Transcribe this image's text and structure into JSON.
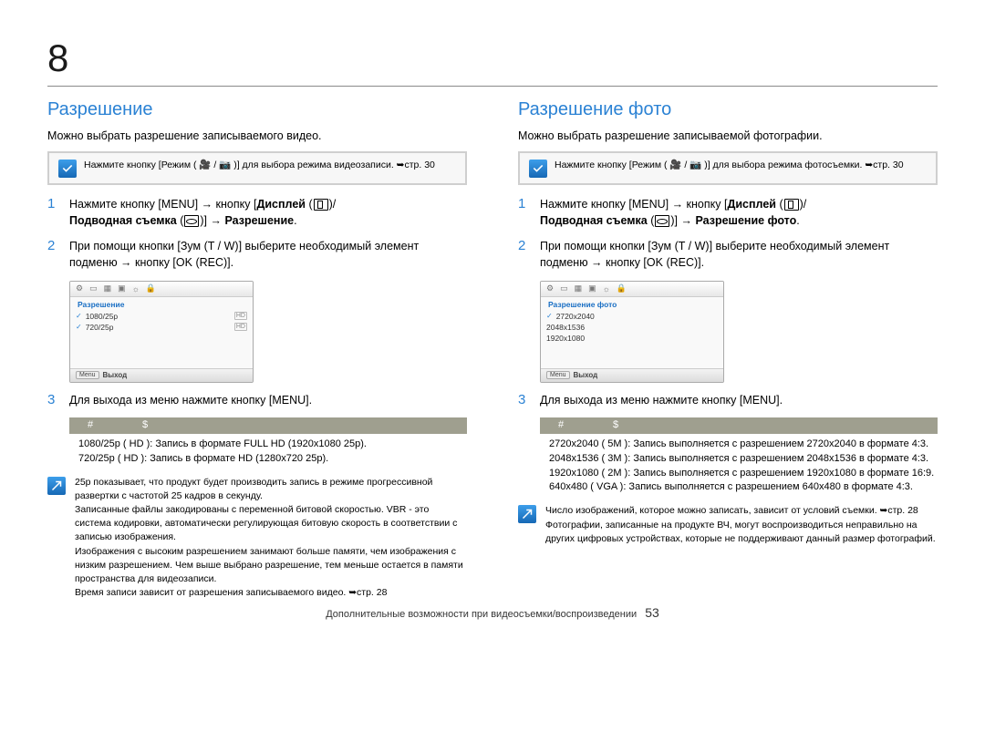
{
  "chapter_number": "8",
  "page_number": "53",
  "footer_text": "Дополнительные возможности при видеосъемки/воспроизведении",
  "left": {
    "title": "Разрешение",
    "intro": "Можно выбрать разрешение записываемого видео.",
    "mode_note": "Нажмите кнопку [Режим ( 🎥 / 📷 )] для выбора режима видеозаписи. ➥стр. 30",
    "step1_a": "Нажмите кнопку [MENU] → кнопку [",
    "step1_b": "Дисплей",
    "step1_c": "Подводная съемка",
    "step1_d": "Разрешение",
    "step2": "При помощи кнопки [Зум (T / W)] выберите необходимый элемент подменю → кнопку [OK (REC)].",
    "step3": "Для выхода из меню нажмите кнопку [MENU].",
    "cam_title": "Разрешение",
    "cam_items": [
      "1080/25p",
      "720/25p"
    ],
    "cam_exit": "Выход",
    "cam_menu": "Menu",
    "table_hash": "#",
    "table_dollar": "$",
    "table_rows": [
      "1080/25p ( HD ): Запись в формате FULL HD (1920x1080 25p).",
      "720/25p ( HD ): Запись в формате HD (1280x720 25p)."
    ],
    "bottom_note": "25p показывает, что продукт будет производить запись в режиме прогрессивной развертки с частотой 25 кадров в секунду.\nЗаписанные файлы закодированы с переменной битовой скоростью. VBR - это система кодировки, автоматически регулирующая битовую скорость в соответствии с записью изображения.\nИзображения с высоким разрешением занимают больше памяти, чем изображения с низким разрешением. Чем выше выбрано разрешение, тем меньше остается в памяти пространства для видеозаписи.\nВремя записи зависит от разрешения записываемого видео. ➥стр. 28"
  },
  "right": {
    "title": "Разрешение фото",
    "intro": "Можно выбрать разрешение записываемой фотографии.",
    "mode_note": "Нажмите кнопку [Режим ( 🎥 / 📷 )] для выбора режима фотосъемки. ➥стр. 30",
    "step1_a": "Нажмите кнопку [MENU] → кнопку [",
    "step1_b": "Дисплей",
    "step1_c": "Подводная съемка",
    "step1_d": "Разрешение фото",
    "step2": "При помощи кнопки [Зум (T / W)] выберите необходимый элемент подменю → кнопку [OK (REC)].",
    "step3": "Для выхода из меню нажмите кнопку [MENU].",
    "cam_title": "Разрешение фото",
    "cam_items": [
      "2720x2040",
      "2048x1536",
      "1920x1080"
    ],
    "cam_exit": "Выход",
    "cam_menu": "Menu",
    "table_hash": "#",
    "table_dollar": "$",
    "table_rows": [
      "2720x2040 ( 5M ): Запись выполняется с разрешением 2720x2040 в формате 4:3.",
      "2048x1536 ( 3M ): Запись выполняется с разрешением 2048x1536 в формате 4:3.",
      "1920x1080 ( 2M ): Запись выполняется с разрешением 1920x1080 в формате 16:9.",
      "640x480 ( VGA ): Запись выполняется с разрешением 640x480 в формате 4:3."
    ],
    "bottom_note": "Число изображений, которое можно записать, зависит от условий съемки. ➥стр. 28\nФотографии, записанные на продукте ВЧ, могут воспроизводиться неправильно на других цифровых устройствах, которые не поддерживают данный размер фотографий."
  }
}
